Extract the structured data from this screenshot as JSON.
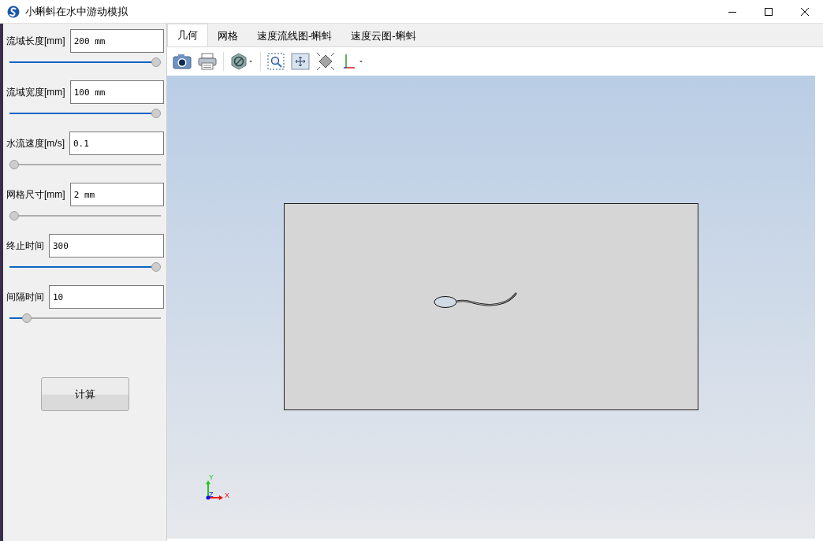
{
  "window": {
    "title": "小蝌蚪在水中游动模拟"
  },
  "params": [
    {
      "label": "流域长度[mm]",
      "value": "200 mm",
      "level": 1
    },
    {
      "label": "流域宽度[mm]",
      "value": "100 mm",
      "level": 1
    },
    {
      "label": "水流速度[m/s]",
      "value": "0.1",
      "level": 0
    },
    {
      "label": "网格尺寸[mm]",
      "value": "2 mm",
      "level": 0
    },
    {
      "label": "终止时间",
      "value": "300",
      "level": 1
    },
    {
      "label": "间隔时间",
      "value": "10",
      "level": 0.09
    }
  ],
  "compute_button": "计算",
  "tabs": [
    {
      "label": "几何",
      "selected": true
    },
    {
      "label": "网格",
      "selected": false
    },
    {
      "label": "速度流线图-蝌蚪",
      "selected": false
    },
    {
      "label": "速度云图-蝌蚪",
      "selected": false
    }
  ],
  "triad": {
    "y": "Y",
    "z": "Z",
    "x": "X"
  }
}
